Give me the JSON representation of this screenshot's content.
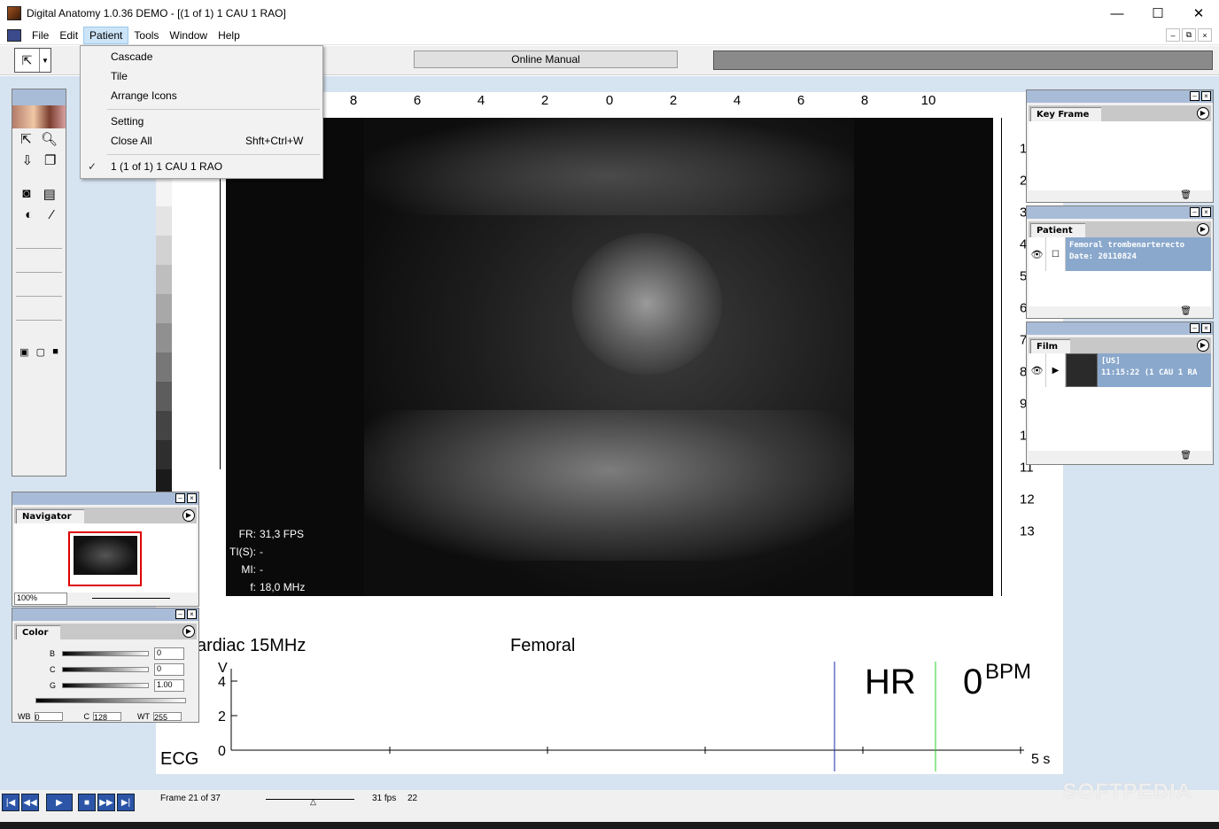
{
  "window": {
    "title": "Digital Anatomy 1.0.36 DEMO - [(1 of 1) 1 CAU 1 RAO]",
    "minimize": "—",
    "maximize": "☐",
    "close": "✕"
  },
  "menubar": {
    "items": [
      "File",
      "Edit",
      "Patient",
      "Tools",
      "Window",
      "Help"
    ],
    "active": "Patient",
    "mdi_buttons": [
      "–",
      "⧉",
      "×"
    ]
  },
  "toolbar": {
    "online_manual": "Online Manual"
  },
  "patient_menu": {
    "items": [
      {
        "label": "Cascade",
        "shortcut": "",
        "checked": false
      },
      {
        "label": "Tile",
        "shortcut": "",
        "checked": false
      },
      {
        "label": "Arrange Icons",
        "shortcut": "",
        "checked": false
      },
      {
        "label": "Setting",
        "shortcut": "",
        "checked": false
      },
      {
        "label": "Close All",
        "shortcut": "Shft+Ctrl+W",
        "checked": false
      },
      {
        "label": "1 (1 of 1) 1 CAU 1 RAO",
        "shortcut": "",
        "checked": true
      }
    ]
  },
  "image": {
    "ruler_top": [
      "8",
      "6",
      "4",
      "2",
      "0",
      "2",
      "4",
      "6",
      "8",
      "10"
    ],
    "ruler_right": [
      "1",
      "2",
      "3",
      "4",
      "5",
      "6",
      "7",
      "8",
      "9",
      "1",
      "11",
      "12",
      "13"
    ],
    "info": [
      {
        "label": "FR:",
        "value": "31,3 FPS"
      },
      {
        "label": "TI(S):",
        "value": "-"
      },
      {
        "label": "MI:",
        "value": "-"
      },
      {
        "label": "f:",
        "value": "18,0 MHz"
      }
    ]
  },
  "ecg": {
    "probe": "ardiac 15MHz",
    "site": "Femoral",
    "label": "ECG",
    "hr_label": "HR",
    "bpm_value": "0",
    "bpm_unit": "BPM",
    "y_unit": "V",
    "y_ticks": [
      "4",
      "2",
      "0"
    ],
    "time_label": "5 s"
  },
  "panels": {
    "key_frame": {
      "title": "Key Frame"
    },
    "patient": {
      "title": "Patient",
      "line1": "Femoral trombenarterecto",
      "line2": "Date: 20110824"
    },
    "film": {
      "title": "Film",
      "line1": "[US]",
      "line2": "11:15:22 (1 CAU 1 RA"
    },
    "navigator": {
      "title": "Navigator",
      "zoom": "100%"
    },
    "color": {
      "title": "Color",
      "rows": [
        {
          "label": "B",
          "value": "0"
        },
        {
          "label": "C",
          "value": "0"
        },
        {
          "label": "G",
          "value": "1.00"
        }
      ],
      "wb_label": "WB",
      "wb_value": "0",
      "c_label": "C",
      "c_value": "128",
      "wt_label": "WT",
      "wt_value": "255"
    }
  },
  "transport": {
    "frame_text": "Frame 21 of 37",
    "fps_text": "31 fps",
    "fps_value": "22",
    "watermark": "SOFTPEDIA"
  }
}
